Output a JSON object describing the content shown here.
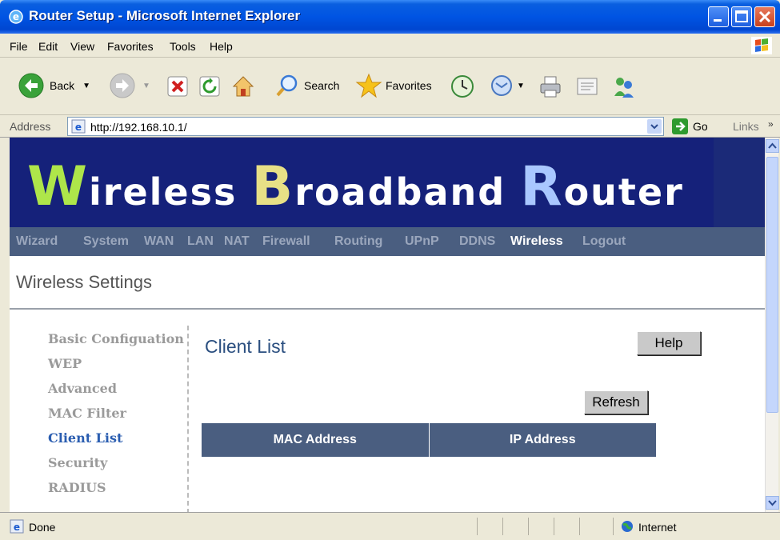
{
  "window": {
    "title": "Router Setup - Microsoft Internet Explorer"
  },
  "menu": [
    "File",
    "Edit",
    "View",
    "Favorites",
    "Tools",
    "Help"
  ],
  "toolbar": {
    "back_label": "Back",
    "search_label": "Search",
    "favorites_label": "Favorites"
  },
  "address": {
    "label": "Address",
    "url": "http://192.168.10.1/",
    "go_label": "Go",
    "links_label": "Links"
  },
  "banner": {
    "w_letter": "W",
    "w_rest": "ireless ",
    "b_letter": "B",
    "b_rest": "roadband ",
    "r_letter": "R",
    "r_rest": "outer"
  },
  "nav": {
    "items": [
      "Wizard",
      "System",
      "WAN",
      "LAN",
      "NAT",
      "Firewall",
      "Routing",
      "UPnP",
      "DDNS",
      "Wireless",
      "Logout"
    ],
    "active": "Wireless"
  },
  "page": {
    "title": "Wireless Settings",
    "side_menu": [
      "Basic Configuation",
      "WEP",
      "Advanced",
      "MAC Filter",
      "Client List",
      "Security",
      "RADIUS"
    ],
    "side_active": "Client List",
    "client_list_title": "Client List",
    "help_label": "Help",
    "refresh_label": "Refresh",
    "table_headers": [
      "MAC Address",
      "IP Address"
    ],
    "table_rows": []
  },
  "status": {
    "text": "Done",
    "zone": "Internet"
  },
  "colors": {
    "banner_bg": "#15217a",
    "nav_bg": "#4a5e80",
    "active_link": "#2a5db0"
  }
}
